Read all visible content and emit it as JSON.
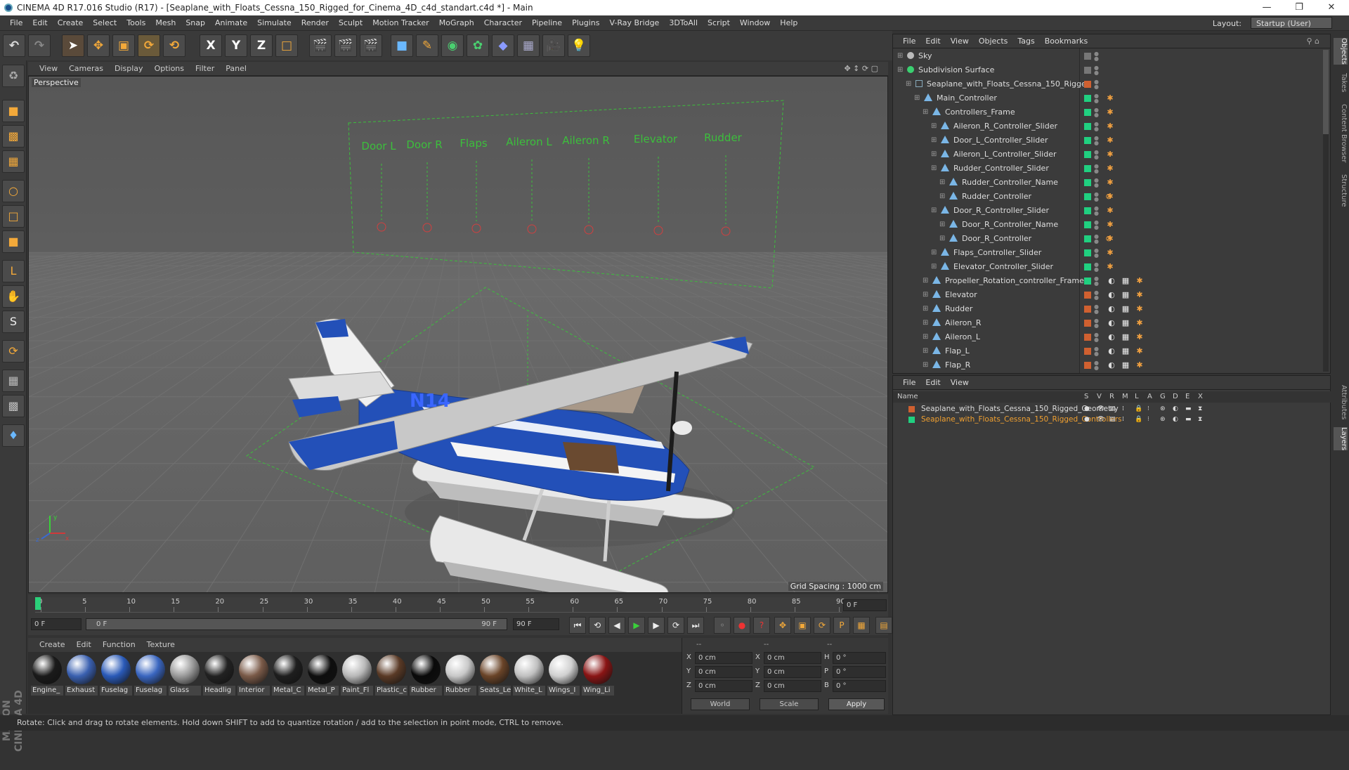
{
  "title": "CINEMA 4D R17.016 Studio (R17) - [Seaplane_with_Floats_Cessna_150_Rigged_for_Cinema_4D_c4d_standart.c4d *] - Main",
  "menu": [
    "File",
    "Edit",
    "Create",
    "Select",
    "Tools",
    "Mesh",
    "Snap",
    "Animate",
    "Simulate",
    "Render",
    "Sculpt",
    "Motion Tracker",
    "MoGraph",
    "Character",
    "Pipeline",
    "Plugins",
    "V-Ray Bridge",
    "3DToAll",
    "Script",
    "Window",
    "Help"
  ],
  "layout_label": "Layout:",
  "layout_value": "Startup (User)",
  "viewport": {
    "menu": [
      "View",
      "Cameras",
      "Display",
      "Options",
      "Filter",
      "Panel"
    ],
    "label": "Perspective",
    "grid": "Grid Spacing : 1000 cm",
    "panel_labels": [
      "Door L",
      "Door R",
      "Flaps",
      "Aileron L",
      "Aileron R",
      "Elevator",
      "Rudder"
    ],
    "tail_number": "N14"
  },
  "timeline": {
    "ticks": [
      "0",
      "5",
      "10",
      "15",
      "20",
      "25",
      "30",
      "35",
      "40",
      "45",
      "50",
      "55",
      "60",
      "65",
      "70",
      "75",
      "80",
      "85",
      "90"
    ],
    "frame_end": "0 F",
    "cur": "0 F",
    "range_start": "0 F",
    "range_end": "90 F",
    "max": "90 F"
  },
  "materials_menu": [
    "Create",
    "Edit",
    "Function",
    "Texture"
  ],
  "materials": [
    {
      "name": "Engine_",
      "color": "#1a1a1a"
    },
    {
      "name": "Exhaust",
      "color": "#3a60b0"
    },
    {
      "name": "Fuselag",
      "color": "#2a5ab8"
    },
    {
      "name": "Fuselag",
      "color": "#3a66c0"
    },
    {
      "name": "Glass",
      "color": "#9a9a9a"
    },
    {
      "name": "Headlig",
      "color": "#222"
    },
    {
      "name": "Interior",
      "color": "#7a5a48"
    },
    {
      "name": "Metal_C",
      "color": "#1e1e1e"
    },
    {
      "name": "Metal_P",
      "color": "#0e0e0e"
    },
    {
      "name": "Paint_Fl",
      "color": "#b8b8b8"
    },
    {
      "name": "Plastic_c",
      "color": "#5a3a26"
    },
    {
      "name": "Rubber",
      "color": "#0a0a0a"
    },
    {
      "name": "Rubber",
      "color": "#c8c8c8"
    },
    {
      "name": "Seats_Le",
      "color": "#6a4428"
    },
    {
      "name": "White_L",
      "color": "#c0c0c0"
    },
    {
      "name": "Wings_I",
      "color": "#d0d0d0"
    },
    {
      "name": "Wing_Li",
      "color": "#8a1414"
    }
  ],
  "coords": {
    "headers": [
      "--",
      "--",
      "--"
    ],
    "rows": [
      {
        "a": "X",
        "av": "0 cm",
        "b": "X",
        "bv": "0 cm",
        "c": "H",
        "cv": "0 °"
      },
      {
        "a": "Y",
        "av": "0 cm",
        "b": "Y",
        "bv": "0 cm",
        "c": "P",
        "cv": "0 °"
      },
      {
        "a": "Z",
        "av": "0 cm",
        "b": "Z",
        "bv": "0 cm",
        "c": "B",
        "cv": "0 °"
      }
    ],
    "world": "World",
    "scale": "Scale",
    "apply": "Apply"
  },
  "status": "Rotate: Click and drag to rotate elements. Hold down SHIFT to add to quantize rotation / add to the selection in point mode, CTRL to remove.",
  "om_menu": [
    "File",
    "Edit",
    "View",
    "Objects",
    "Tags",
    "Bookmarks"
  ],
  "objects": [
    {
      "name": "Sky",
      "indent": 0,
      "icon": "sky",
      "layer": "#777"
    },
    {
      "name": "Subdivision Surface",
      "indent": 0,
      "icon": "subd",
      "layer": "#777"
    },
    {
      "name": "Seaplane_with_Floats_Cessna_150_Rigged",
      "indent": 1,
      "icon": "null",
      "layer": "#d06030"
    },
    {
      "name": "Main_Controller",
      "indent": 2,
      "icon": "tri",
      "layer": "#20d080"
    },
    {
      "name": "Controllers_Frame",
      "indent": 3,
      "icon": "tri",
      "layer": "#20d080"
    },
    {
      "name": "Aileron_R_Controller_Slider",
      "indent": 4,
      "icon": "tri",
      "layer": "#20d080"
    },
    {
      "name": "Door_L_Controller_Slider",
      "indent": 4,
      "icon": "tri",
      "layer": "#20d080"
    },
    {
      "name": "Aileron_L_Controller_Slider",
      "indent": 4,
      "icon": "tri",
      "layer": "#20d080"
    },
    {
      "name": "Rudder_Controller_Slider",
      "indent": 4,
      "icon": "tri",
      "layer": "#20d080"
    },
    {
      "name": "Rudder_Controller_Name",
      "indent": 5,
      "icon": "tri",
      "layer": "#20d080"
    },
    {
      "name": "Rudder_Controller",
      "indent": 5,
      "icon": "tri",
      "layer": "#20d080"
    },
    {
      "name": "Door_R_Controller_Slider",
      "indent": 4,
      "icon": "tri",
      "layer": "#20d080"
    },
    {
      "name": "Door_R_Controller_Name",
      "indent": 5,
      "icon": "tri",
      "layer": "#20d080"
    },
    {
      "name": "Door_R_Controller",
      "indent": 5,
      "icon": "tri",
      "layer": "#20d080"
    },
    {
      "name": "Flaps_Controller_Slider",
      "indent": 4,
      "icon": "tri",
      "layer": "#20d080"
    },
    {
      "name": "Elevator_Controller_Slider",
      "indent": 4,
      "icon": "tri",
      "layer": "#20d080"
    },
    {
      "name": "Propeller_Rotation_controller_Frame",
      "indent": 3,
      "icon": "tri",
      "layer": "#20d080"
    },
    {
      "name": "Elevator",
      "indent": 3,
      "icon": "tri",
      "layer": "#d06030"
    },
    {
      "name": "Rudder",
      "indent": 3,
      "icon": "tri",
      "layer": "#d06030"
    },
    {
      "name": "Aileron_R",
      "indent": 3,
      "icon": "tri",
      "layer": "#d06030"
    },
    {
      "name": "Aileron_L",
      "indent": 3,
      "icon": "tri",
      "layer": "#d06030"
    },
    {
      "name": "Flap_L",
      "indent": 3,
      "icon": "tri",
      "layer": "#d06030"
    },
    {
      "name": "Flap_R",
      "indent": 3,
      "icon": "tri",
      "layer": "#d06030"
    }
  ],
  "lm_menu": [
    "File",
    "Edit",
    "View"
  ],
  "lm_headers": [
    "Name",
    "S",
    "V",
    "R",
    "M",
    "L",
    "A",
    "G",
    "D",
    "E",
    "X"
  ],
  "layers": [
    {
      "name": "Seaplane_with_Floats_Cessna_150_Rigged_Geometry",
      "color": "#d06030",
      "text": "#ddd"
    },
    {
      "name": "Seaplane_with_Floats_Cessna_150_Rigged_Controllers",
      "color": "#20d080",
      "text": "#f0a030"
    }
  ],
  "right_tabs": [
    "Objects",
    "Takes",
    "Content Browser",
    "Structure",
    "Attributes",
    "Layers"
  ]
}
